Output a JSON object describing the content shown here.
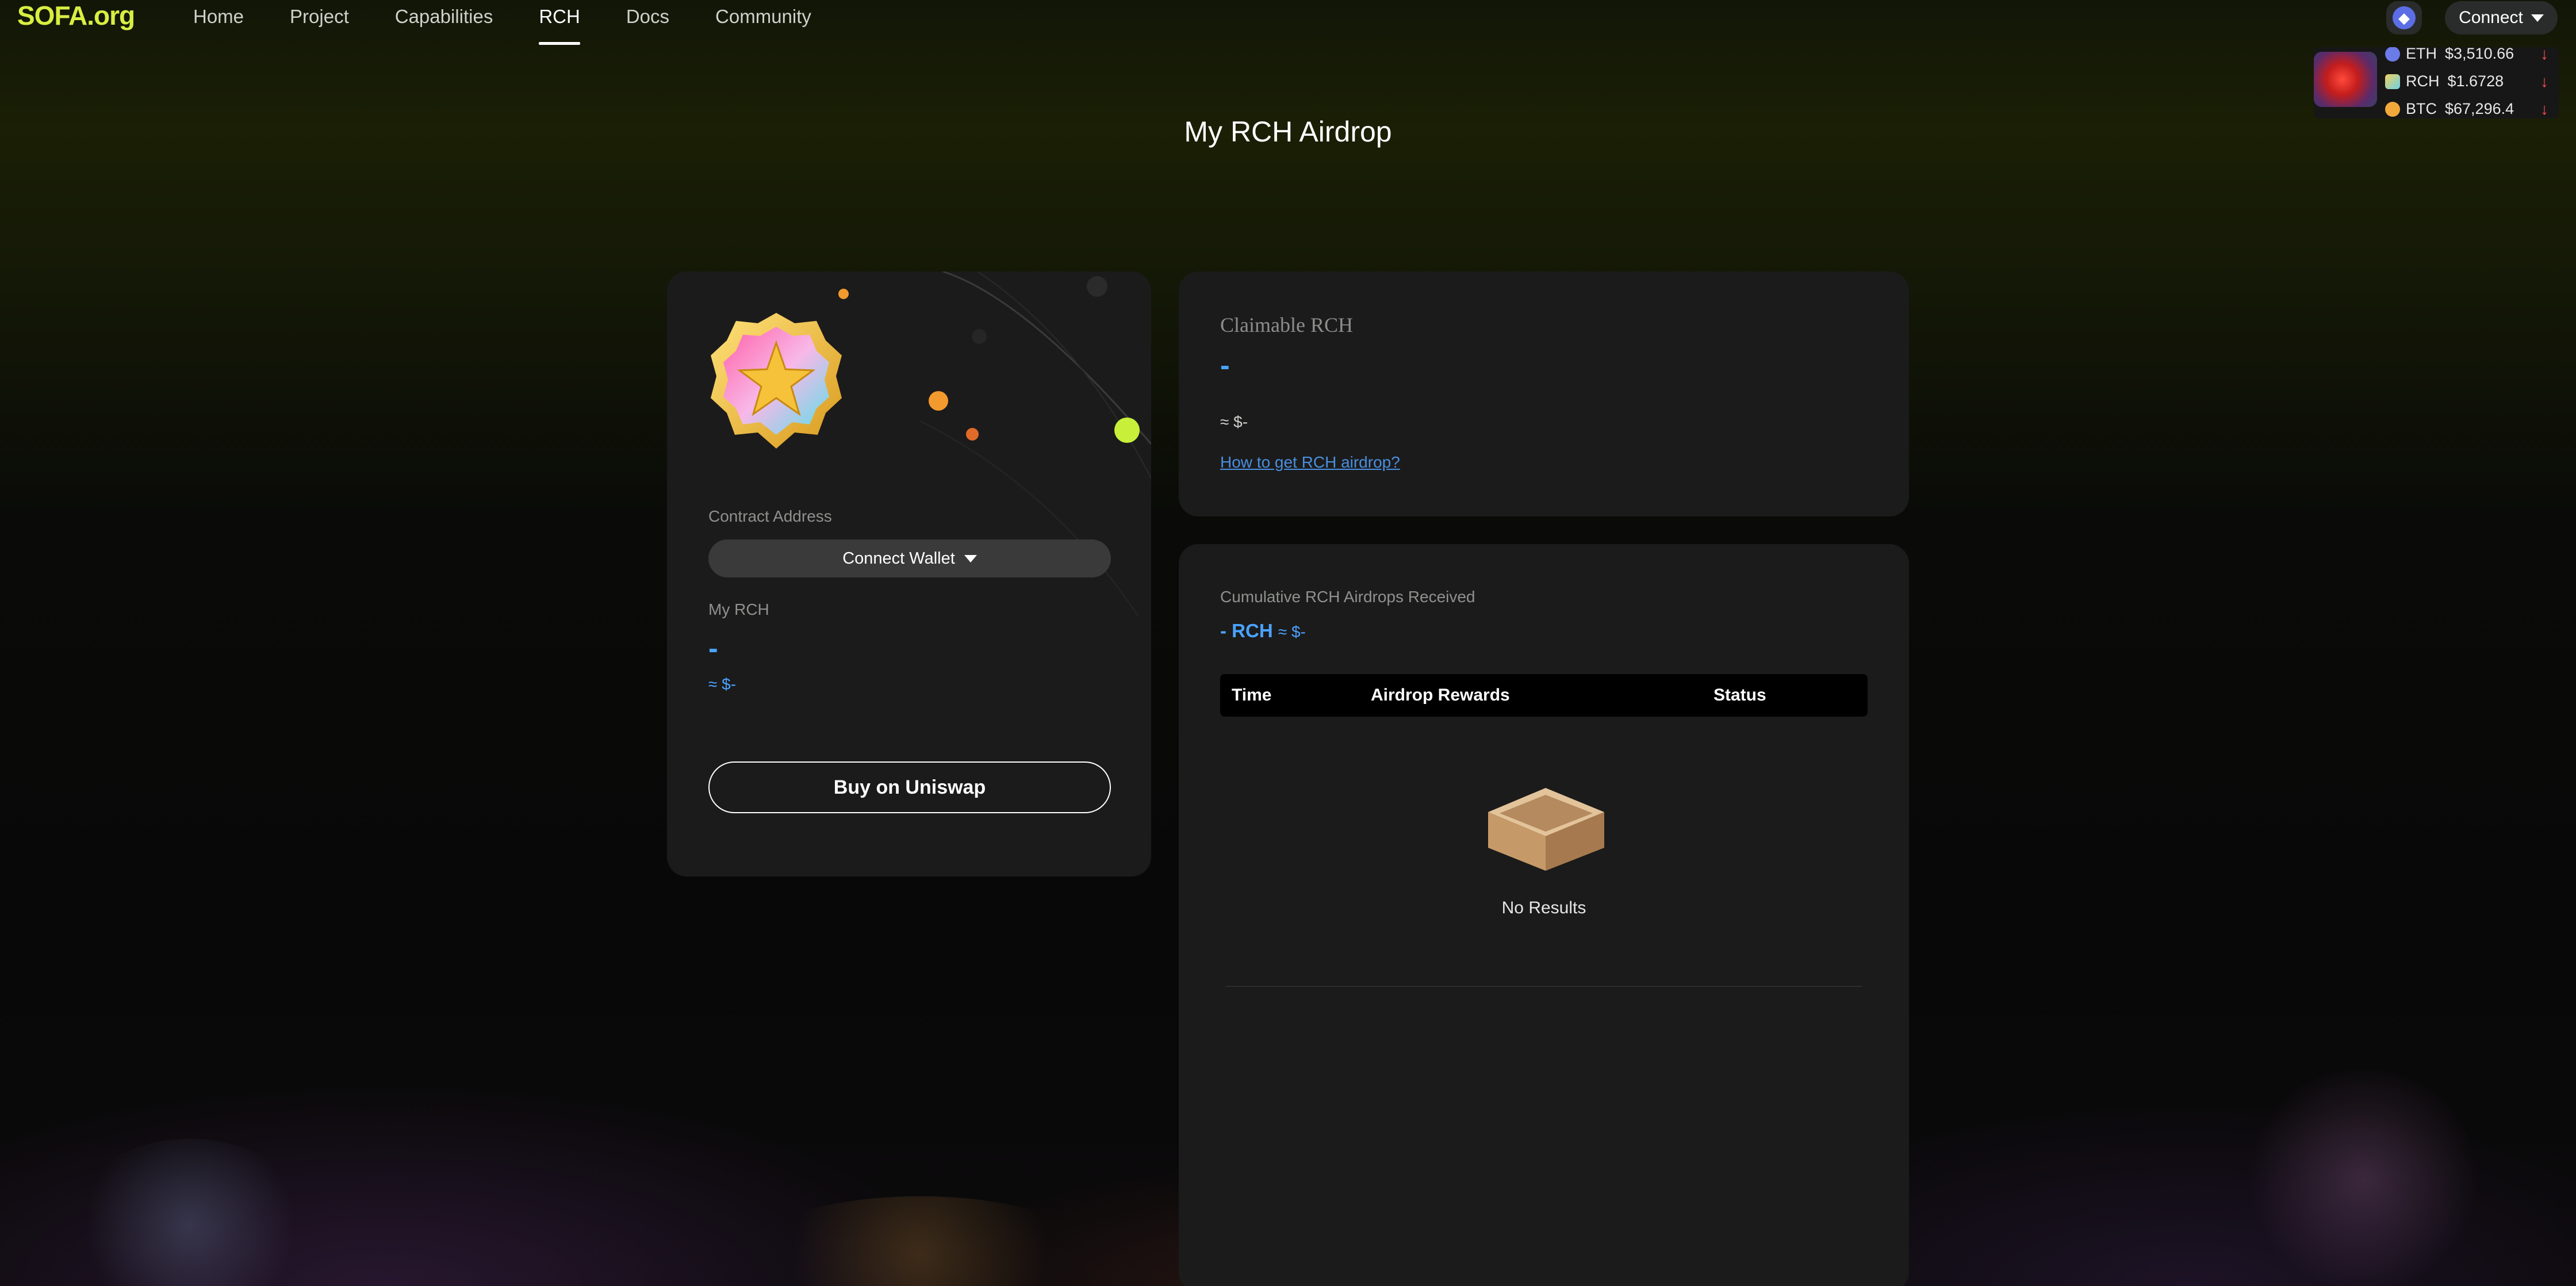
{
  "nav": {
    "logo": "SOFA.org",
    "links": [
      "Home",
      "Project",
      "Capabilities",
      "RCH",
      "Docs",
      "Community"
    ],
    "active": "RCH",
    "network_icon": "ethereum-icon",
    "connect_label": "Connect"
  },
  "ticker": {
    "items": [
      {
        "symbol": "ETH",
        "price": "$3,510.66",
        "trend": "down",
        "color": "#6b7be8"
      },
      {
        "symbol": "RCH",
        "price": "$1.6728",
        "trend": "down",
        "color": "#e8c24a"
      },
      {
        "symbol": "BTC",
        "price": "$67,296.4",
        "trend": "down",
        "color": "#f2a93b"
      }
    ]
  },
  "page": {
    "title": "My RCH Airdrop"
  },
  "left_card": {
    "contract_label": "Contract Address",
    "connect_wallet_label": "Connect Wallet",
    "my_rch_label": "My RCH",
    "my_rch_value": "-",
    "my_rch_usd": "≈ $-",
    "buy_label": "Buy on Uniswap"
  },
  "claim_card": {
    "label": "Claimable RCH",
    "value": "-",
    "usd": "≈ $-",
    "link": "How to get RCH airdrop?"
  },
  "cumulative_card": {
    "label": "Cumulative RCH Airdrops Received",
    "value": "- RCH",
    "usd": "≈ $-",
    "columns": [
      "Time",
      "Airdrop Rewards",
      "Status"
    ],
    "empty_text": "No Results"
  },
  "colors": {
    "accent_blue": "#4aa3ff",
    "logo_green": "#d8ee43",
    "card_bg": "#1b1b1b"
  }
}
